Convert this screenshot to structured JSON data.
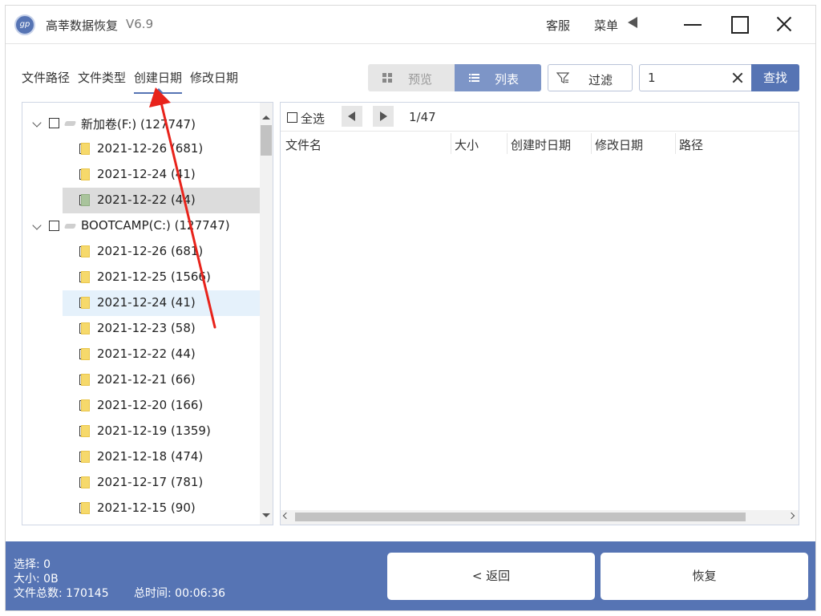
{
  "app": {
    "logo_text": "gp",
    "title": "高莘数据恢复",
    "version": "V6.9"
  },
  "titlebar": {
    "service": "客服",
    "menu": "菜单"
  },
  "tabs": [
    {
      "label": "文件路径"
    },
    {
      "label": "文件类型"
    },
    {
      "label": "创建日期",
      "active": true
    },
    {
      "label": "修改日期"
    }
  ],
  "toolbar": {
    "preview_label": "预览",
    "list_label": "列表",
    "filter_label": "过滤",
    "search_value": "1",
    "search_button": "查找"
  },
  "tree": {
    "rows": [
      {
        "label": "新加卷(F:)  (127747)",
        "type": "drive",
        "level": 0
      },
      {
        "label": "2021-12-26  (681)",
        "type": "folder",
        "level": 1
      },
      {
        "label": "2021-12-24  (41)",
        "type": "folder",
        "level": 1
      },
      {
        "label": "2021-12-22  (44)",
        "type": "folder",
        "level": 1,
        "selected": "grey",
        "folder_color": "green"
      },
      {
        "label": "BOOTCAMP(C:)  (127747)",
        "type": "drive",
        "level": 0
      },
      {
        "label": "2021-12-26  (681)",
        "type": "folder",
        "level": 1
      },
      {
        "label": "2021-12-25  (1566)",
        "type": "folder",
        "level": 1
      },
      {
        "label": "2021-12-24  (41)",
        "type": "folder",
        "level": 1,
        "selected": "blue"
      },
      {
        "label": "2021-12-23  (58)",
        "type": "folder",
        "level": 1
      },
      {
        "label": "2021-12-22  (44)",
        "type": "folder",
        "level": 1
      },
      {
        "label": "2021-12-21  (66)",
        "type": "folder",
        "level": 1
      },
      {
        "label": "2021-12-20  (166)",
        "type": "folder",
        "level": 1
      },
      {
        "label": "2021-12-19  (1359)",
        "type": "folder",
        "level": 1
      },
      {
        "label": "2021-12-18  (474)",
        "type": "folder",
        "level": 1
      },
      {
        "label": "2021-12-17  (781)",
        "type": "folder",
        "level": 1
      },
      {
        "label": "2021-12-15  (90)",
        "type": "folder",
        "level": 1
      }
    ]
  },
  "list": {
    "select_all": "全选",
    "page": "1/47",
    "columns": [
      "文件名",
      "大小",
      "创建时日期",
      "修改日期",
      "路径"
    ]
  },
  "status": {
    "selected": "选择:  0",
    "size": "大小:  0B",
    "total": "文件总数:  170145",
    "time": "总时间:  00:06:36"
  },
  "buttons": {
    "back": "< 返回",
    "recover": "恢复"
  },
  "colors": {
    "accent": "#5674b4",
    "list_toggle": "#7d95c7",
    "annotation": "#e8231b"
  }
}
